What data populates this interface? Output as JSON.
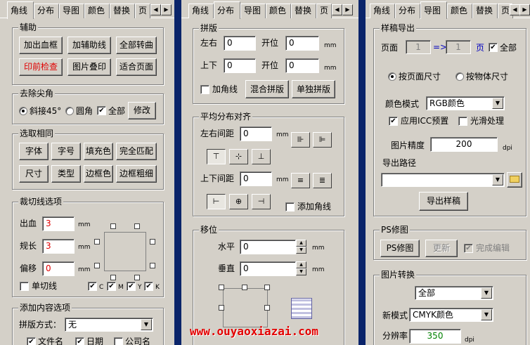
{
  "colors": {
    "separator": "#0a246a",
    "red_text": "#e00000",
    "green_text": "#008000",
    "watermark": "#e30000"
  },
  "panel1": {
    "tabs": [
      "角线",
      "分布",
      "导图",
      "颜色",
      "替换",
      "页"
    ],
    "aux": {
      "title": "辅助",
      "buttons": [
        "加出血框",
        "加辅助线",
        "全部转曲",
        "印前检查",
        "图片叠印",
        "适合页面"
      ]
    },
    "corner": {
      "title": "去除尖角",
      "opt1": "斜接45°",
      "opt2": "圆角",
      "all": "全部",
      "modify": "修改"
    },
    "select_same": {
      "title": "选取相同",
      "buttons": [
        "字体",
        "字号",
        "填充色",
        "完全匹配",
        "尺寸",
        "类型",
        "边框色",
        "边框粗细"
      ]
    },
    "crop": {
      "title": "裁切线选项",
      "bleed_label": "出血",
      "bleed_value": "3",
      "length_label": "规长",
      "length_value": "3",
      "offset_label": "偏移",
      "offset_value": "0",
      "unit": "mm",
      "single": "单切线",
      "channels": [
        "C",
        "M",
        "Y",
        "K"
      ]
    },
    "add_content": {
      "title": "添加内容选项",
      "mode_label": "拼版方式：",
      "mode_value": "无",
      "opts": [
        "文件名",
        "日期",
        "公司名"
      ]
    }
  },
  "panel2": {
    "tabs": [
      "角线",
      "分布",
      "导图",
      "颜色",
      "替换",
      "页"
    ],
    "imposition": {
      "title": "拼版",
      "lr_label": "左右",
      "lr_value": "0",
      "lr_open_label": "开位",
      "lr_open_value": "0",
      "ud_label": "上下",
      "ud_value": "0",
      "ud_open_label": "开位",
      "ud_open_value": "0",
      "unit": "mm",
      "add_marks": "加角线",
      "mixed": "混合拼版",
      "single": "单独拼版"
    },
    "distribute": {
      "title": "平均分布对齐",
      "h_label": "左右间距",
      "h_value": "0",
      "v_label": "上下间距",
      "v_value": "0",
      "unit": "mm",
      "add_marks": "添加角线"
    },
    "move": {
      "title": "移位",
      "h_label": "水平",
      "h_value": "0",
      "v_label": "垂直",
      "v_value": "0",
      "unit": "mm"
    }
  },
  "panel3": {
    "tabs": [
      "角线",
      "分布",
      "导图",
      "颜色",
      "替换",
      "页"
    ],
    "export": {
      "title": "样稿导出",
      "page_label": "页面",
      "from": "1",
      "arrow": "=>",
      "to": "1",
      "page_unit": "页",
      "all": "全部",
      "by_page": "按页面尺寸",
      "by_object": "按物体尺寸",
      "color_mode_label": "颜色模式",
      "color_mode_value": "RGB颜色",
      "icc": "应用ICC预置",
      "smooth": "光滑处理",
      "precision_label": "图片精度",
      "precision_value": "200",
      "precision_unit": "dpi",
      "path_label": "导出路径",
      "path_value": "",
      "export_btn": "导出样稿"
    },
    "ps": {
      "title": "PS修图",
      "btn": "PS修图",
      "update": "更新",
      "done": "完成编辑"
    },
    "convert": {
      "title": "图片转换",
      "scope": "全部",
      "mode_label": "新模式",
      "mode_value": "CMYK颜色",
      "res_label": "分辨率",
      "res_value": "350",
      "res_unit": "dpi"
    }
  },
  "watermark": "www.ouyaoxiazai.com"
}
